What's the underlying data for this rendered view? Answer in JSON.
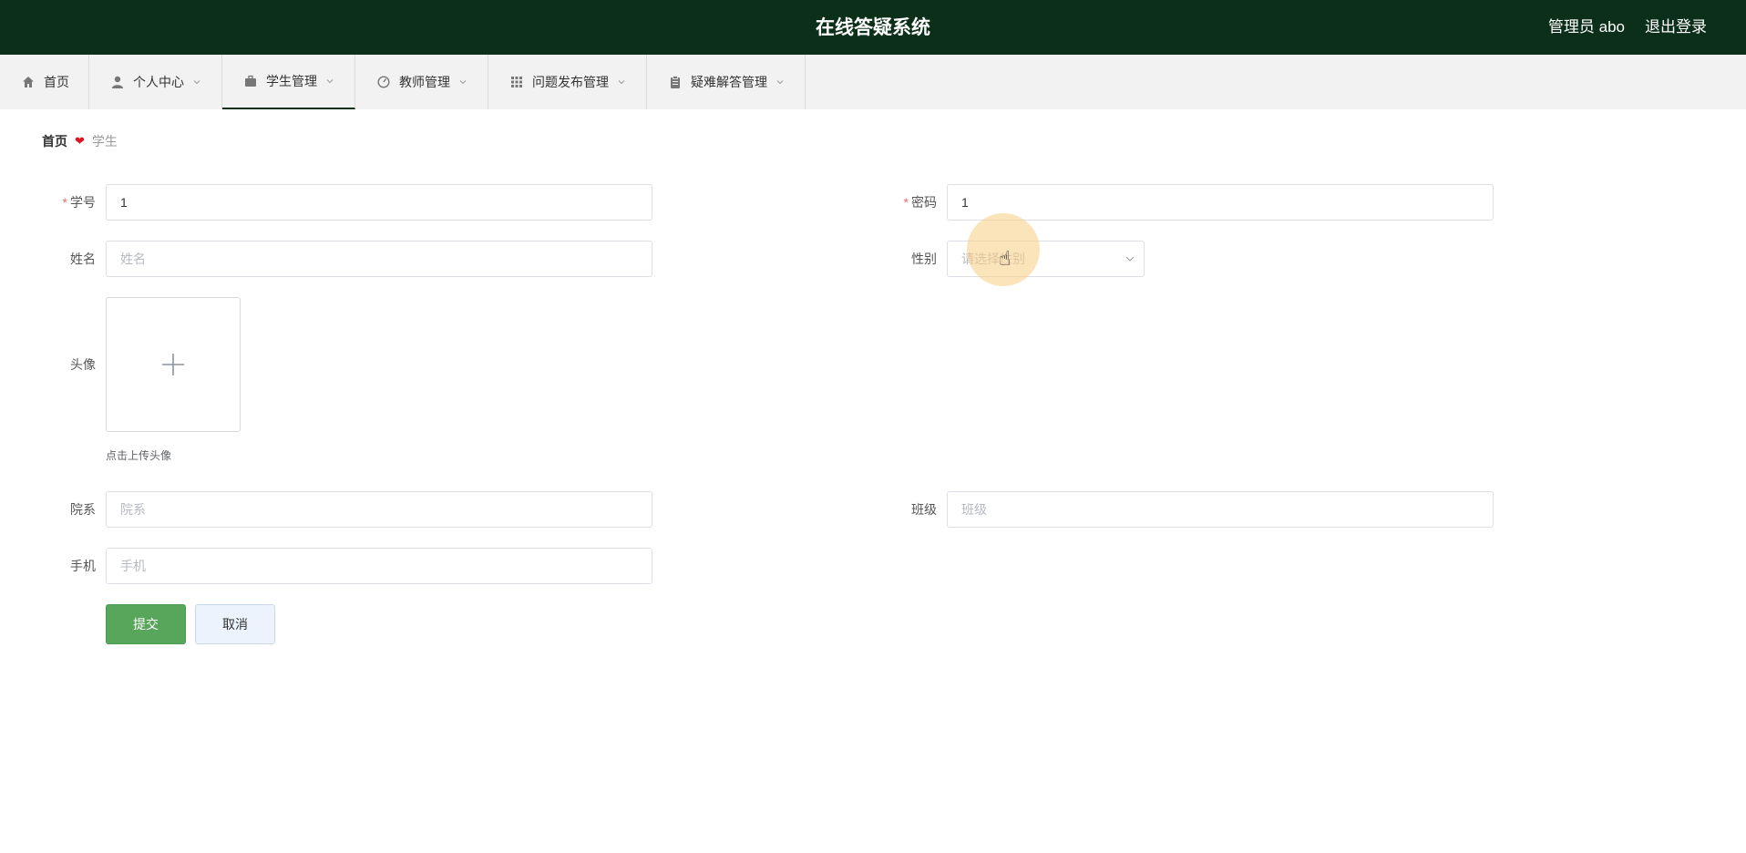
{
  "header": {
    "title": "在线答疑系统",
    "user_label": "管理员 abo",
    "logout_label": "退出登录"
  },
  "nav": {
    "items": [
      {
        "label": "首页",
        "icon": "home-icon",
        "has_dropdown": false,
        "active": false
      },
      {
        "label": "个人中心",
        "icon": "user-icon",
        "has_dropdown": true,
        "active": false
      },
      {
        "label": "学生管理",
        "icon": "briefcase-icon",
        "has_dropdown": true,
        "active": true
      },
      {
        "label": "教师管理",
        "icon": "gauge-icon",
        "has_dropdown": true,
        "active": false
      },
      {
        "label": "问题发布管理",
        "icon": "grid-icon",
        "has_dropdown": true,
        "active": false
      },
      {
        "label": "疑难解答管理",
        "icon": "clipboard-icon",
        "has_dropdown": true,
        "active": false
      }
    ]
  },
  "breadcrumb": {
    "home": "首页",
    "current": "学生"
  },
  "form": {
    "student_id": {
      "label": "学号",
      "value": "1",
      "required": true
    },
    "password": {
      "label": "密码",
      "value": "1",
      "required": true
    },
    "name": {
      "label": "姓名",
      "value": "",
      "placeholder": "姓名"
    },
    "gender": {
      "label": "性别",
      "value": "",
      "placeholder": "请选择性别"
    },
    "avatar": {
      "label": "头像",
      "hint": "点击上传头像"
    },
    "department": {
      "label": "院系",
      "value": "",
      "placeholder": "院系"
    },
    "class": {
      "label": "班级",
      "value": "",
      "placeholder": "班级"
    },
    "phone": {
      "label": "手机",
      "value": "",
      "placeholder": "手机"
    }
  },
  "actions": {
    "submit_label": "提交",
    "cancel_label": "取消"
  },
  "colors": {
    "header_bg": "#0c2f1a",
    "submit_bg": "#58a55c",
    "cancel_bg": "#ecf3fd",
    "required_star": "#f56c6c",
    "breadcrumb_heart": "#e0141e"
  }
}
